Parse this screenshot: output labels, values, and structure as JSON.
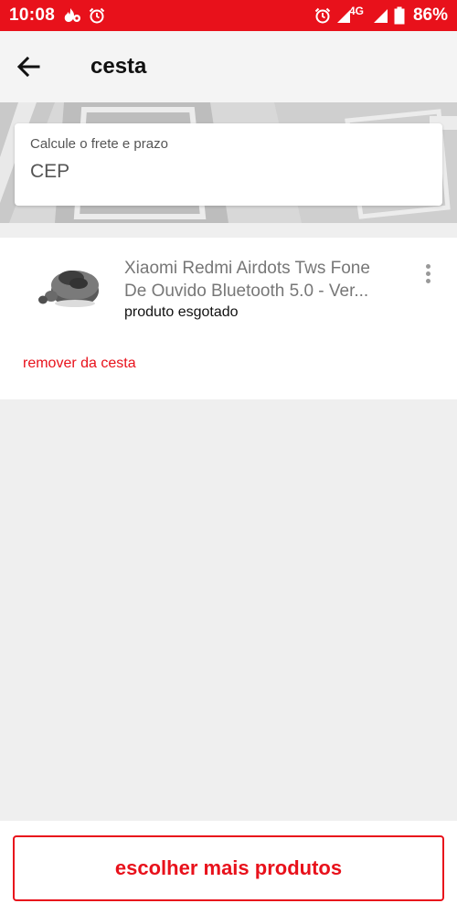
{
  "status_bar": {
    "time": "10:08",
    "network": "4G",
    "battery": "86%",
    "icons": [
      "fire-icon",
      "alarm-icon",
      "alarm-icon",
      "signal-icon",
      "signal-icon",
      "battery-icon"
    ]
  },
  "header": {
    "title": "cesta",
    "back_icon": "arrow-left-icon"
  },
  "shipping": {
    "label": "Calcule o frete e prazo",
    "cep_placeholder": "CEP"
  },
  "cart": {
    "items": [
      {
        "name_line1": "Xiaomi Redmi Airdots Tws Fone",
        "name_line2": "De Ouvido Bluetooth 5.0 - Ver...",
        "status": "produto esgotado",
        "remove_label": "remover da cesta",
        "menu_icon": "more-vertical-icon",
        "image": "earbuds-product-image"
      }
    ]
  },
  "footer": {
    "choose_more_label": "escolher mais produtos"
  },
  "colors": {
    "brand_red": "#e8111b",
    "background": "#efefef",
    "header_bg": "#f4f4f4"
  }
}
